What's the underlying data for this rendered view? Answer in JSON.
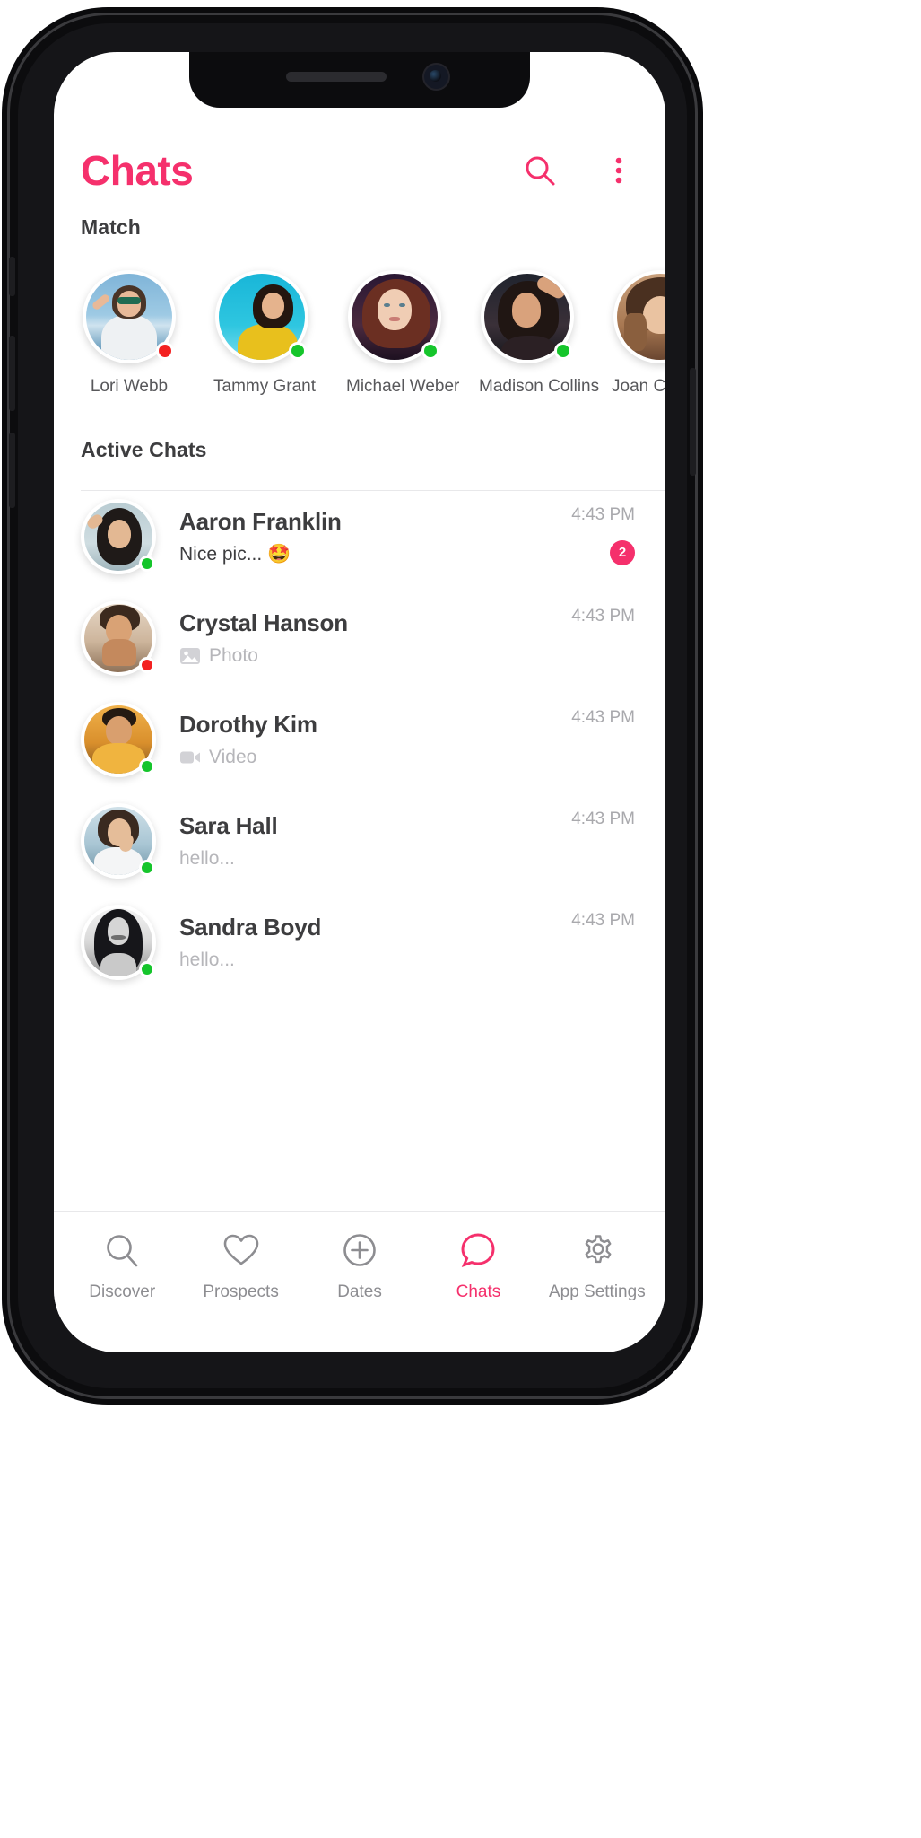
{
  "header": {
    "title": "Chats",
    "search_icon": "search-icon",
    "menu_icon": "overflow-menu-icon",
    "accent_color": "#f5306c"
  },
  "match": {
    "section_title": "Match",
    "items": [
      {
        "name": "Lori Webb",
        "status": "offline",
        "photo": "beach-sunglasses"
      },
      {
        "name": "Tammy Grant",
        "status": "online",
        "photo": "teal-yellow-top"
      },
      {
        "name": "Michael Weber",
        "status": "online",
        "photo": "auburn-hair-portrait"
      },
      {
        "name": "Madison Collins",
        "status": "online",
        "photo": "dark-arm-up-portrait"
      },
      {
        "name": "Joan Cooper",
        "status": "online",
        "photo": "tattoo-blonde-portrait"
      }
    ]
  },
  "chats": {
    "section_title": "Active Chats",
    "rows": [
      {
        "name": "Aaron Franklin",
        "preview": "Nice pic... 🤩",
        "preview_type": "text",
        "time": "4:43 PM",
        "status": "online",
        "unread": "2",
        "photo": "pale-blue-portrait"
      },
      {
        "name": "Crystal Hanson",
        "preview": "Photo",
        "preview_type": "photo",
        "time": "4:43 PM",
        "status": "offline",
        "unread": "",
        "photo": "beige-hands-portrait"
      },
      {
        "name": "Dorothy Kim",
        "preview": "Video",
        "preview_type": "video",
        "time": "4:43 PM",
        "status": "online",
        "unread": "",
        "photo": "amber-shirt-portrait"
      },
      {
        "name": "Sara Hall",
        "preview": "hello...",
        "preview_type": "text-muted",
        "time": "4:43 PM",
        "status": "online",
        "unread": "",
        "photo": "white-top-portrait"
      },
      {
        "name": "Sandra Boyd",
        "preview": "hello...",
        "preview_type": "text-muted",
        "time": "4:43 PM",
        "status": "online",
        "unread": "",
        "photo": "bw-long-hair-portrait"
      }
    ]
  },
  "tab_bar": {
    "active_index": 3,
    "items": [
      {
        "label": "Discover",
        "icon": "search-icon"
      },
      {
        "label": "Prospects",
        "icon": "heart-icon"
      },
      {
        "label": "Dates",
        "icon": "plus-circle-icon"
      },
      {
        "label": "Chats",
        "icon": "chat-bubble-icon"
      },
      {
        "label": "App Settings",
        "icon": "gear-icon"
      }
    ]
  },
  "colors": {
    "accent": "#f5306c",
    "online": "#15c52b",
    "offline": "#f32121",
    "text_primary": "#3d3d3f",
    "text_muted": "#b6b6ba",
    "time": "#a9a9ad"
  }
}
